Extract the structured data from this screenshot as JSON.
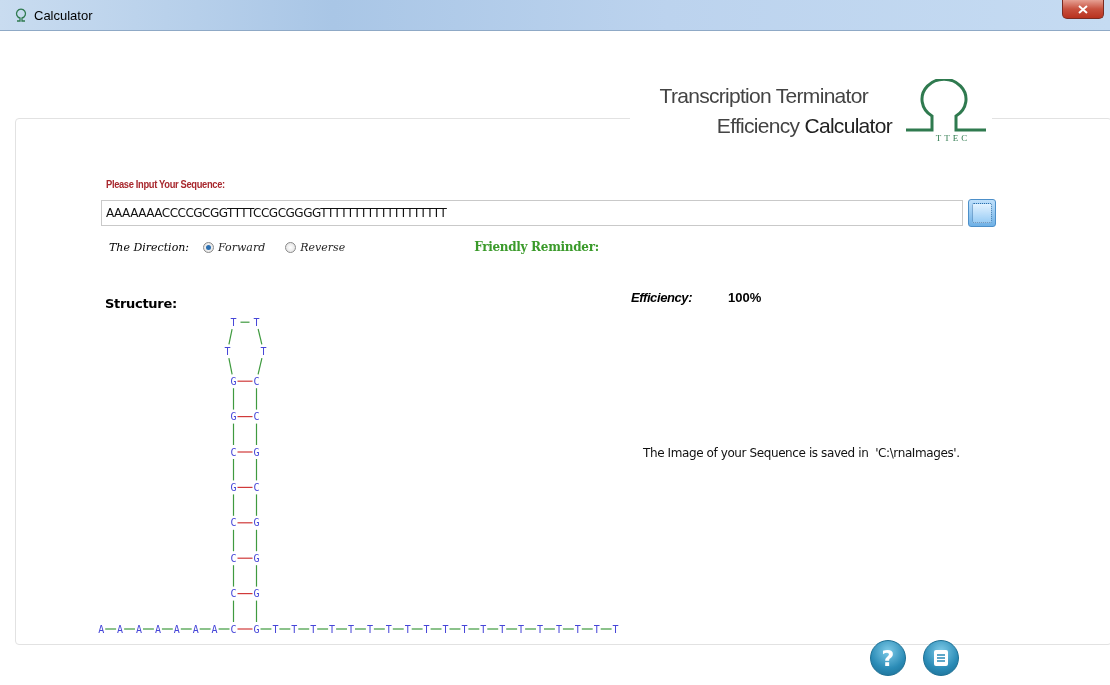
{
  "window": {
    "title": "Calculator"
  },
  "logo": {
    "line1": "Transcription Terminator",
    "line2": "Efficiency **Calculator**",
    "mark": "TTEC"
  },
  "sequence": {
    "label": "Please Input Your Sequence:",
    "value": "AAAAAAACCCCGCGGTTTTCCGCGGGGTTTTTTTTTTTTTTTTTTT"
  },
  "direction": {
    "label": "The Direction:",
    "options": [
      {
        "label": "Forward",
        "selected": true
      },
      {
        "label": "Reverse",
        "selected": false
      }
    ]
  },
  "reminder": {
    "label": "Friendly Reminder:"
  },
  "efficiency": {
    "label": "Efficiency:",
    "value": "100%"
  },
  "message": "The Image of your Sequence is saved in  'C:\\rnaImages'.",
  "structure": {
    "label": "Structure:",
    "five_prime": [
      "A",
      "A",
      "A",
      "A",
      "A",
      "A",
      "A"
    ],
    "stem": [
      {
        "left": "G",
        "right": "C"
      },
      {
        "left": "G",
        "right": "C"
      },
      {
        "left": "C",
        "right": "G"
      },
      {
        "left": "G",
        "right": "C"
      },
      {
        "left": "C",
        "right": "G"
      },
      {
        "left": "C",
        "right": "G"
      },
      {
        "left": "C",
        "right": "G"
      },
      {
        "left": "C",
        "right": "G"
      }
    ],
    "loop": [
      "T",
      "T",
      "T",
      "T"
    ],
    "three_prime": [
      "T",
      "T",
      "T",
      "T",
      "T",
      "T",
      "T",
      "T",
      "T",
      "T",
      "T",
      "T",
      "T",
      "T",
      "T",
      "T",
      "T",
      "T",
      "T"
    ]
  },
  "help_button": {
    "label": "?"
  }
}
